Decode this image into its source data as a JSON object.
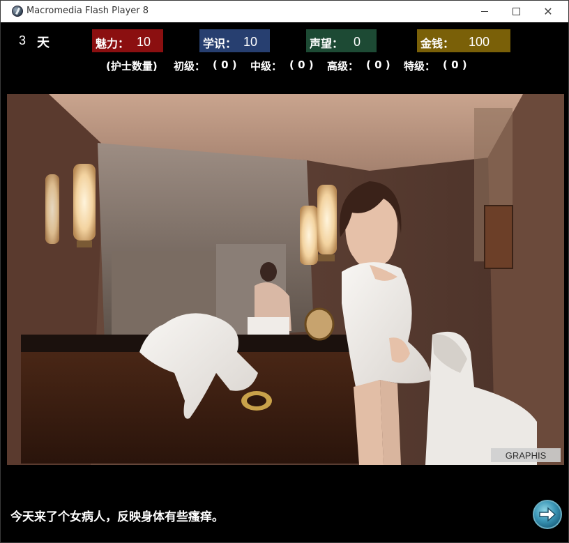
{
  "window": {
    "title": "Macromedia Flash Player 8",
    "close_glyph": "✕"
  },
  "status": {
    "day_number": "3",
    "day_unit": "天"
  },
  "stats": {
    "charm": {
      "label": "魅力：",
      "value": "10",
      "color": "#8b0f10"
    },
    "knowledge": {
      "label": "学识：",
      "value": "10",
      "color": "#273f70"
    },
    "fame": {
      "label": "声望：",
      "value": "0",
      "color": "#1d4a34"
    },
    "money": {
      "label": "金钱：",
      "value": "100",
      "color": "#7a6008"
    }
  },
  "nurses": {
    "title": "(护士数量)",
    "beginner_label": "初级：",
    "beginner_value": "( 0 )",
    "intermediate_label": "中级：",
    "intermediate_value": "( 0 )",
    "advanced_label": "高级：",
    "advanced_value": "( 0 )",
    "special_label": "特级：",
    "special_value": "( 0 )"
  },
  "scene": {
    "watermark": "GRAPHIS"
  },
  "dialog": {
    "message": "今天来了个女病人，反映身体有些瘙痒。"
  },
  "controls": {
    "next_icon": "arrow-right-icon"
  }
}
